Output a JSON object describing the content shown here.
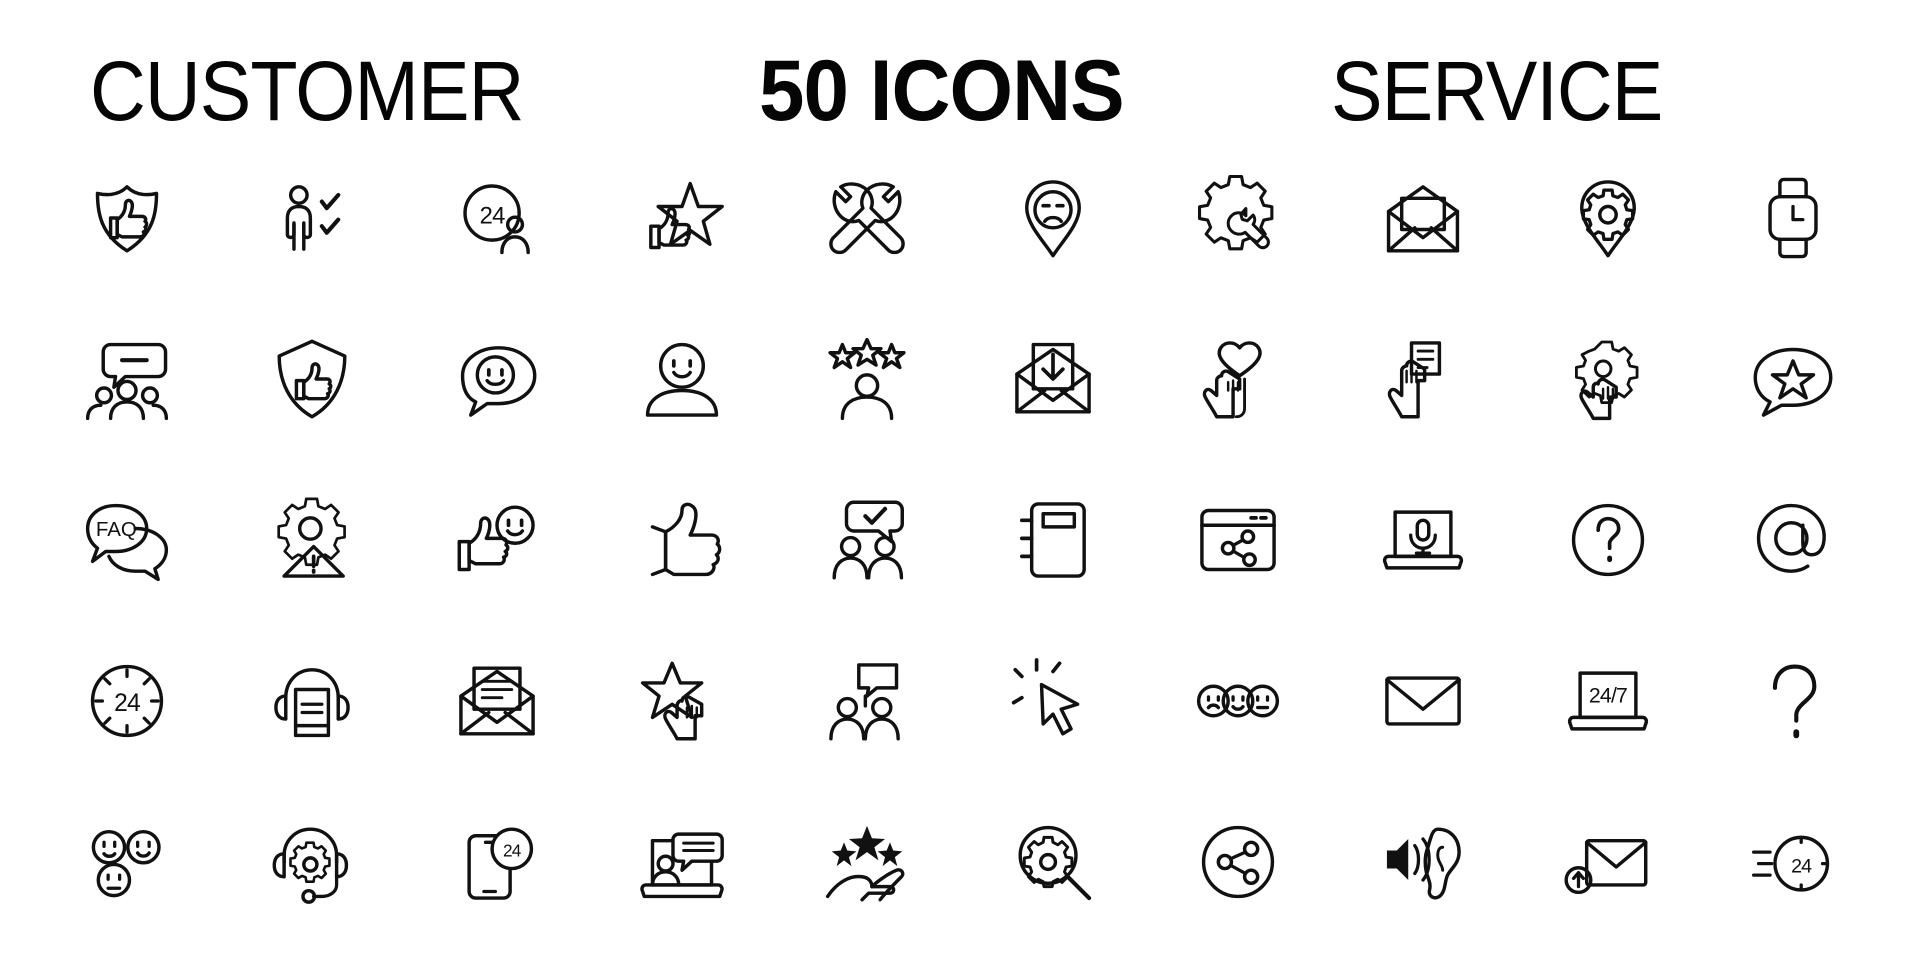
{
  "header": {
    "left_title": "CUSTOMER",
    "center_title": "50 ICONS",
    "right_title": "SERVICE"
  },
  "style": {
    "stroke_color": "#111111",
    "background_color": "#ffffff",
    "stroke_width": "4.2"
  },
  "icon_labels": {
    "i1": "24",
    "i2": "FAQ",
    "i3": "24",
    "i4": "24/7",
    "i5": "24",
    "i6": "24"
  },
  "grid": {
    "columns": 10,
    "rows": 5,
    "total": 50
  },
  "icons": [
    {
      "id": 1,
      "name": "shield-thumbs-up-icon",
      "label": "Shield with thumbs up"
    },
    {
      "id": 2,
      "name": "person-checklist-icon",
      "label": "Person with checkmarks"
    },
    {
      "id": 3,
      "name": "24-hour-support-person-icon",
      "label": "24 hour support agent"
    },
    {
      "id": 4,
      "name": "star-thumbs-up-icon",
      "label": "Star rating with thumbs up"
    },
    {
      "id": 5,
      "name": "wrench-screwdriver-icon",
      "label": "Crossed wrench and screwdriver"
    },
    {
      "id": 6,
      "name": "location-pin-sad-face-icon",
      "label": "Location pin with sad face"
    },
    {
      "id": 7,
      "name": "gear-wrench-icon",
      "label": "Gear with wrench"
    },
    {
      "id": 8,
      "name": "open-envelope-letter-icon",
      "label": "Open envelope with letter"
    },
    {
      "id": 9,
      "name": "location-pin-gear-icon",
      "label": "Location pin with gear"
    },
    {
      "id": 10,
      "name": "smartwatch-icon",
      "label": "Smartwatch"
    },
    {
      "id": 11,
      "name": "group-chat-bubble-icon",
      "label": "Group of people with chat bubble"
    },
    {
      "id": 12,
      "name": "shield-thumbs-up-outline-icon",
      "label": "Shield with thumbs up"
    },
    {
      "id": 13,
      "name": "smiley-chat-bubble-icon",
      "label": "Chat bubble with smiley"
    },
    {
      "id": 14,
      "name": "happy-user-icon",
      "label": "User with smiling face"
    },
    {
      "id": 15,
      "name": "person-three-stars-icon",
      "label": "Person with three stars"
    },
    {
      "id": 16,
      "name": "envelope-download-icon",
      "label": "Envelope with download arrow"
    },
    {
      "id": 17,
      "name": "heart-click-icon",
      "label": "Hand clicking heart"
    },
    {
      "id": 18,
      "name": "hand-holding-card-icon",
      "label": "Hand holding card"
    },
    {
      "id": 19,
      "name": "gear-click-icon",
      "label": "Hand clicking gear"
    },
    {
      "id": 20,
      "name": "star-chat-bubble-icon",
      "label": "Chat bubble with star"
    },
    {
      "id": 21,
      "name": "faq-chat-bubbles-icon",
      "label": "FAQ chat bubbles"
    },
    {
      "id": 22,
      "name": "gear-warning-icon",
      "label": "Gear with warning triangle"
    },
    {
      "id": 23,
      "name": "thumbs-up-smiley-icon",
      "label": "Thumbs up with smiley"
    },
    {
      "id": 24,
      "name": "thumbs-up-icon",
      "label": "Thumbs up"
    },
    {
      "id": 25,
      "name": "two-people-check-chat-icon",
      "label": "Two people with approved chat"
    },
    {
      "id": 26,
      "name": "notebook-icon",
      "label": "Notebook"
    },
    {
      "id": 27,
      "name": "browser-share-icon",
      "label": "Browser window with share"
    },
    {
      "id": 28,
      "name": "laptop-microphone-icon",
      "label": "Laptop with microphone"
    },
    {
      "id": 29,
      "name": "question-circle-icon",
      "label": "Question mark in circle"
    },
    {
      "id": 30,
      "name": "at-sign-circle-icon",
      "label": "At sign in circle"
    },
    {
      "id": 31,
      "name": "clock-24-icon",
      "label": "24 hour clock"
    },
    {
      "id": 32,
      "name": "headset-document-icon",
      "label": "Headset with document"
    },
    {
      "id": 33,
      "name": "open-mail-letter-icon",
      "label": "Open mail with letter"
    },
    {
      "id": 34,
      "name": "star-rating-click-icon",
      "label": "Hand clicking star rating"
    },
    {
      "id": 35,
      "name": "presentation-people-icon",
      "label": "People with presentation board"
    },
    {
      "id": 36,
      "name": "cursor-click-icon",
      "label": "Mouse cursor click"
    },
    {
      "id": 37,
      "name": "three-faces-feedback-icon",
      "label": "Three feedback faces"
    },
    {
      "id": 38,
      "name": "envelope-icon",
      "label": "Envelope"
    },
    {
      "id": 39,
      "name": "laptop-24-7-icon",
      "label": "Laptop showing 24/7"
    },
    {
      "id": 40,
      "name": "question-mark-icon",
      "label": "Question mark"
    },
    {
      "id": 41,
      "name": "three-emoji-faces-icon",
      "label": "Three emoji faces"
    },
    {
      "id": 42,
      "name": "headset-gear-icon",
      "label": "Headset with gear"
    },
    {
      "id": 43,
      "name": "mobile-24-support-icon",
      "label": "Mobile phone 24 support"
    },
    {
      "id": 44,
      "name": "laptop-video-chat-icon",
      "label": "Laptop with video chat"
    },
    {
      "id": 45,
      "name": "hand-stars-rating-icon",
      "label": "Hand holding stars"
    },
    {
      "id": 46,
      "name": "gear-magnifier-icon",
      "label": "Magnifier with gear"
    },
    {
      "id": 47,
      "name": "share-circle-icon",
      "label": "Share nodes in circle"
    },
    {
      "id": 48,
      "name": "ear-speaker-icon",
      "label": "Ear with speaker sound"
    },
    {
      "id": 49,
      "name": "envelope-upload-icon",
      "label": "Envelope with upload arrow"
    },
    {
      "id": 50,
      "name": "clock-24-speed-icon",
      "label": "Fast 24 hour clock"
    }
  ]
}
